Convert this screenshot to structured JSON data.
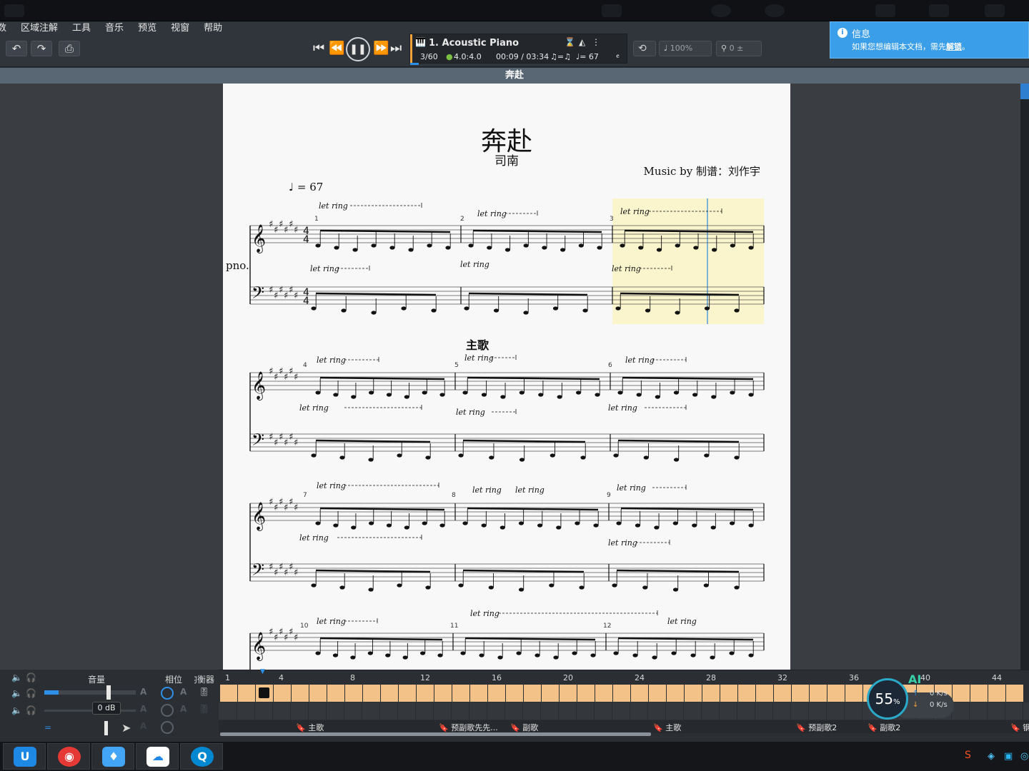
{
  "menu": [
    "数",
    "区域注解",
    "工具",
    "音乐",
    "预览",
    "视窗",
    "帮助"
  ],
  "transport": {
    "track_name": "1. Acoustic Piano",
    "bar_position": "3/60",
    "time_signature": "4.0:4.0",
    "time": "00:09 / 03:34",
    "swing": "♫=♫",
    "tempo_readout": "♩= 67",
    "zoom": "100%",
    "tuning": "0"
  },
  "info_popup": {
    "title": "信息",
    "message_pre": "如果您想编辑本文档，需先",
    "message_link": "解锁",
    "message_post": "。"
  },
  "document": {
    "title": "奔赴",
    "song_title": "奔赴",
    "artist": "司南",
    "composer": "Music by 制谱：刘作宇",
    "tempo": "= 67",
    "instrument": "pno.",
    "section_label": "主歌",
    "let_ring": "let ring",
    "measure_numbers": [
      "1",
      "2",
      "3",
      "4",
      "5",
      "6",
      "7",
      "8",
      "9",
      "10",
      "11",
      "12"
    ]
  },
  "mixer": {
    "volume_label": "音量",
    "phase_label": "相位",
    "eq_label": "均衡器",
    "db_tooltip": "0 dB",
    "ruler": [
      "1",
      "4",
      "8",
      "12",
      "16",
      "20",
      "24",
      "28",
      "32",
      "36",
      "40",
      "44"
    ],
    "markers": [
      "主歌",
      "预副歌先先...",
      "副歌",
      "主歌",
      "预副歌2",
      "副歌2",
      "钢"
    ]
  },
  "network": {
    "percent": "55",
    "percent_unit": "%",
    "up": "0 K/s",
    "down": "0 K/s",
    "ai_label": "AI"
  },
  "colors": {
    "note_bar": "#f2c288",
    "accent_blue": "#3a9ee8",
    "playing_highlight": "#fbf5cd",
    "marker_orange": "#f0a33b"
  }
}
